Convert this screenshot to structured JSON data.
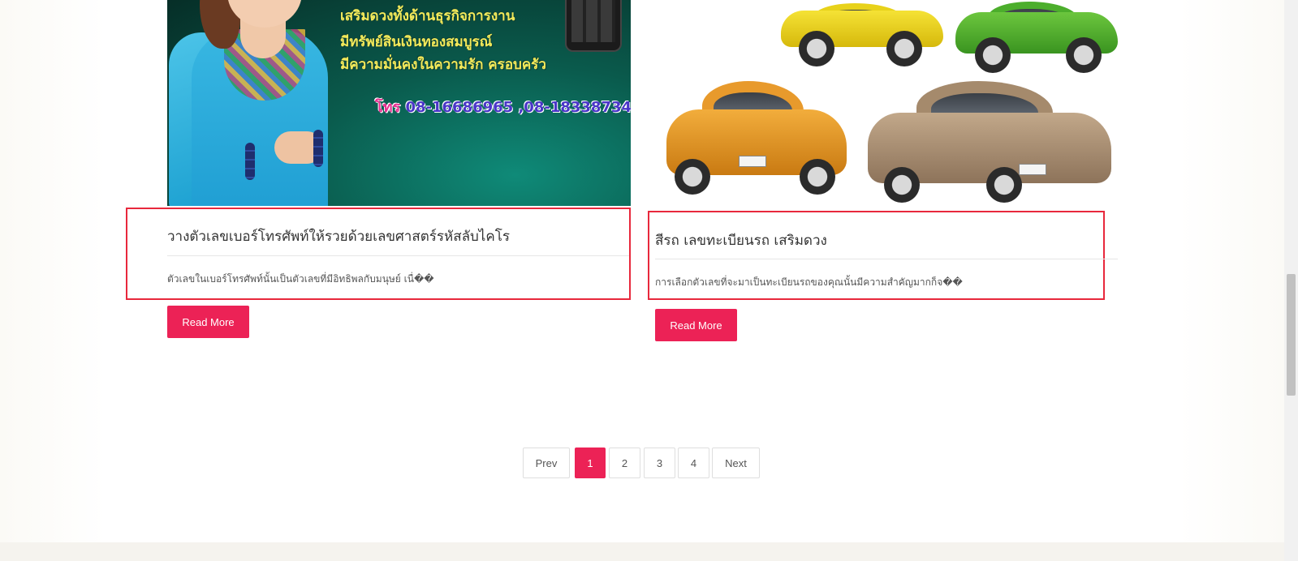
{
  "posts": [
    {
      "promo_lines": [
        "เสริมดวงทั้งด้านธุรกิจการงาน",
        "มีทรัพย์สินเงินทองสมบูรณ์",
        "มีความมั่นคงในความรัก ครอบครัว"
      ],
      "promo_phone_label": "โทร",
      "promo_phone_numbers": "08-16686965 ,08-18338734",
      "title": "วางตัวเลขเบอร์โทรศัพท์ให้รวยด้วยเลขศาสตร์รหัสลับไคโร",
      "excerpt": "ตัวเลขในเบอร์โทรศัพท์นั้นเป็นตัวเลขที่มีอิทธิพลกับมนุษย์ เนื่��",
      "read_more_label": "Read More"
    },
    {
      "title": "สีรถ เลขทะเบียนรถ เสริมดวง",
      "excerpt": "การเลือกตัวเลขที่จะมาเป็นทะเบียนรถของคุณนั้นมีความสำคัญมากก็จ��",
      "read_more_label": "Read More"
    }
  ],
  "pagination": {
    "prev_label": "Prev",
    "pages": [
      "1",
      "2",
      "3",
      "4"
    ],
    "current_page": "1",
    "next_label": "Next"
  },
  "colors": {
    "accent": "#ec2256",
    "highlight_border": "#e8283c",
    "footer": "#f5f3ee"
  }
}
